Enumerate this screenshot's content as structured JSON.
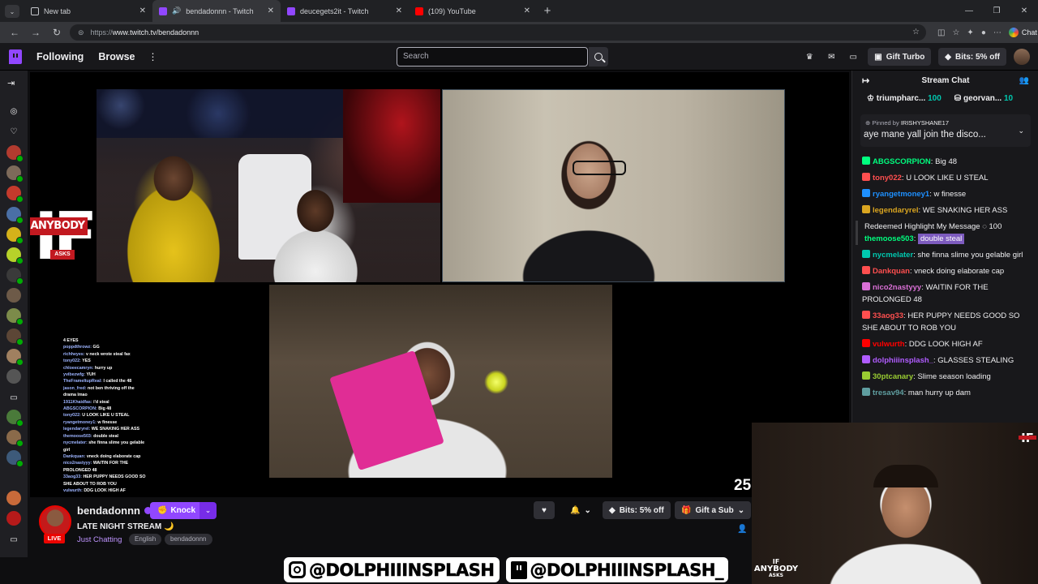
{
  "browser": {
    "tabs": [
      {
        "label": "New tab",
        "active": false
      },
      {
        "label": "bendadonnn - Twitch",
        "active": true
      },
      {
        "label": "deucegets2it - Twitch",
        "active": false
      },
      {
        "label": "(109) YouTube",
        "active": false
      }
    ],
    "url_prefix": "https://",
    "url_main": "www.twitch.tv/bendadonnn",
    "chat_label": "Chat"
  },
  "twitch": {
    "nav": {
      "following": "Following",
      "browse": "Browse",
      "search_placeholder": "Search",
      "gift_turbo": "Gift Turbo",
      "bits": "Bits: 5% off"
    },
    "channel": {
      "name": "bendadonnn",
      "knock": "Knock",
      "title": "LATE NIGHT STREAM 🌙",
      "category": "Just Chatting",
      "tags": [
        "English",
        "bendadonnn"
      ],
      "live": "LIVE",
      "bits": "Bits: 5% off",
      "gift": "Gift a Sub"
    },
    "stream_overlay": {
      "logo_big": "IF",
      "logo_mid": "ANYBODY",
      "logo_small": "ASKS",
      "counter": "25",
      "handle1": "@DOLPHIIINSPLASH",
      "handle2": "@DOLPHIIINSPLASH_",
      "chat_lines": [
        {
          "u": "",
          "t": "4 EYES"
        },
        {
          "u": "poppdthrowz:",
          "t": "GG"
        },
        {
          "u": "richheyes:",
          "t": "v neck wrote steal fax"
        },
        {
          "u": "tony022:",
          "t": "YES"
        },
        {
          "u": "chloeecamryn:",
          "t": "hurry up"
        },
        {
          "u": "yvibezwfg:",
          "t": "YUH"
        },
        {
          "u": "TheFrameItupReal:",
          "t": "I called the 48"
        },
        {
          "u": "jason_fred:",
          "t": "not ben thriving off the"
        },
        {
          "u": "",
          "t": "drama lmao"
        },
        {
          "u": "1911Khaidfas:",
          "t": "i'd steal"
        },
        {
          "u": "ABGSCORPION:",
          "t": "Big 48"
        },
        {
          "u": "tony022:",
          "t": "U LOOK LIKE U STEAL"
        },
        {
          "u": "ryangetmoney1:",
          "t": "w finesse"
        },
        {
          "u": "legendaryrel:",
          "t": "WE SNAKING HER ASS"
        },
        {
          "u": "themoose503:",
          "t": "double steal"
        },
        {
          "u": "nycmelater:",
          "t": "she finna slime you gelable"
        },
        {
          "u": "",
          "t": "girl"
        },
        {
          "u": "Dankquan:",
          "t": "vneck doing elaborate cap"
        },
        {
          "u": "nico2nastyyy:",
          "t": "WAITIN FOR THE"
        },
        {
          "u": "",
          "t": "PROLONGED 48"
        },
        {
          "u": "33aog33:",
          "t": "HER PUPPY NEEDS GOOD SO"
        },
        {
          "u": "",
          "t": "SHE ABOUT TO ROB YOU"
        },
        {
          "u": "vulwurth:",
          "t": "DDG LOOK HIGH AF"
        }
      ],
      "webcam_watermark": {
        "if": "IF",
        "mid": "ANYBODY",
        "asks": "ASKS"
      },
      "corner_mark": "IF"
    },
    "chat": {
      "header": "Stream Chat",
      "leaders": [
        {
          "name": "triumpharc...",
          "count": "100"
        },
        {
          "name": "georvan...",
          "count": "10"
        }
      ],
      "pinned_by_label": "Pinned by",
      "pinned_by": "IRISHYSHANE17",
      "pinned_msg": "aye mane yall join the disco...",
      "messages": [
        {
          "user": "ABGSCORPION",
          "color": "#00ff7f",
          "text": "Big 48"
        },
        {
          "user": "tony022",
          "color": "#ff4f4f",
          "text": "U LOOK LIKE U STEAL"
        },
        {
          "user": "ryangetmoney1",
          "color": "#1e90ff",
          "text": "w finesse"
        },
        {
          "user": "legendaryrel",
          "color": "#daa520",
          "text": "WE SNAKING HER ASS"
        }
      ],
      "highlight": {
        "label": "Redeemed Highlight My Message",
        "cost": "100",
        "user": "themoose503",
        "text": "double steal"
      },
      "messages2": [
        {
          "user": "nycmelater",
          "color": "#00c8af",
          "text": "she finna slime you gelable girl"
        },
        {
          "user": "Dankquan",
          "color": "#ff4f4f",
          "text": "vneck doing elaborate cap"
        },
        {
          "user": "nico2nastyyy",
          "color": "#da70d6",
          "text": "WAITIN FOR THE PROLONGED 48"
        },
        {
          "user": "33aog33",
          "color": "#ff4f4f",
          "text": "HER PUPPY NEEDS GOOD SO SHE ABOUT TO ROB YOU"
        },
        {
          "user": "vulwurth",
          "color": "#ff0000",
          "text": "DDG LOOK HIGH AF"
        },
        {
          "user": "dolphiiinsplash_",
          "color": "#b05cff",
          "text": "GLASSES STEALING"
        },
        {
          "user": "30ptcanary",
          "color": "#9acd32",
          "text": "Slime season loading"
        },
        {
          "user": "tresav94",
          "color": "#5f9ea0",
          "text": "man hurry up dam"
        }
      ]
    }
  },
  "colors": {
    "brand": "#9147ff",
    "live": "#eb0400",
    "bg": "#0e0e10"
  }
}
